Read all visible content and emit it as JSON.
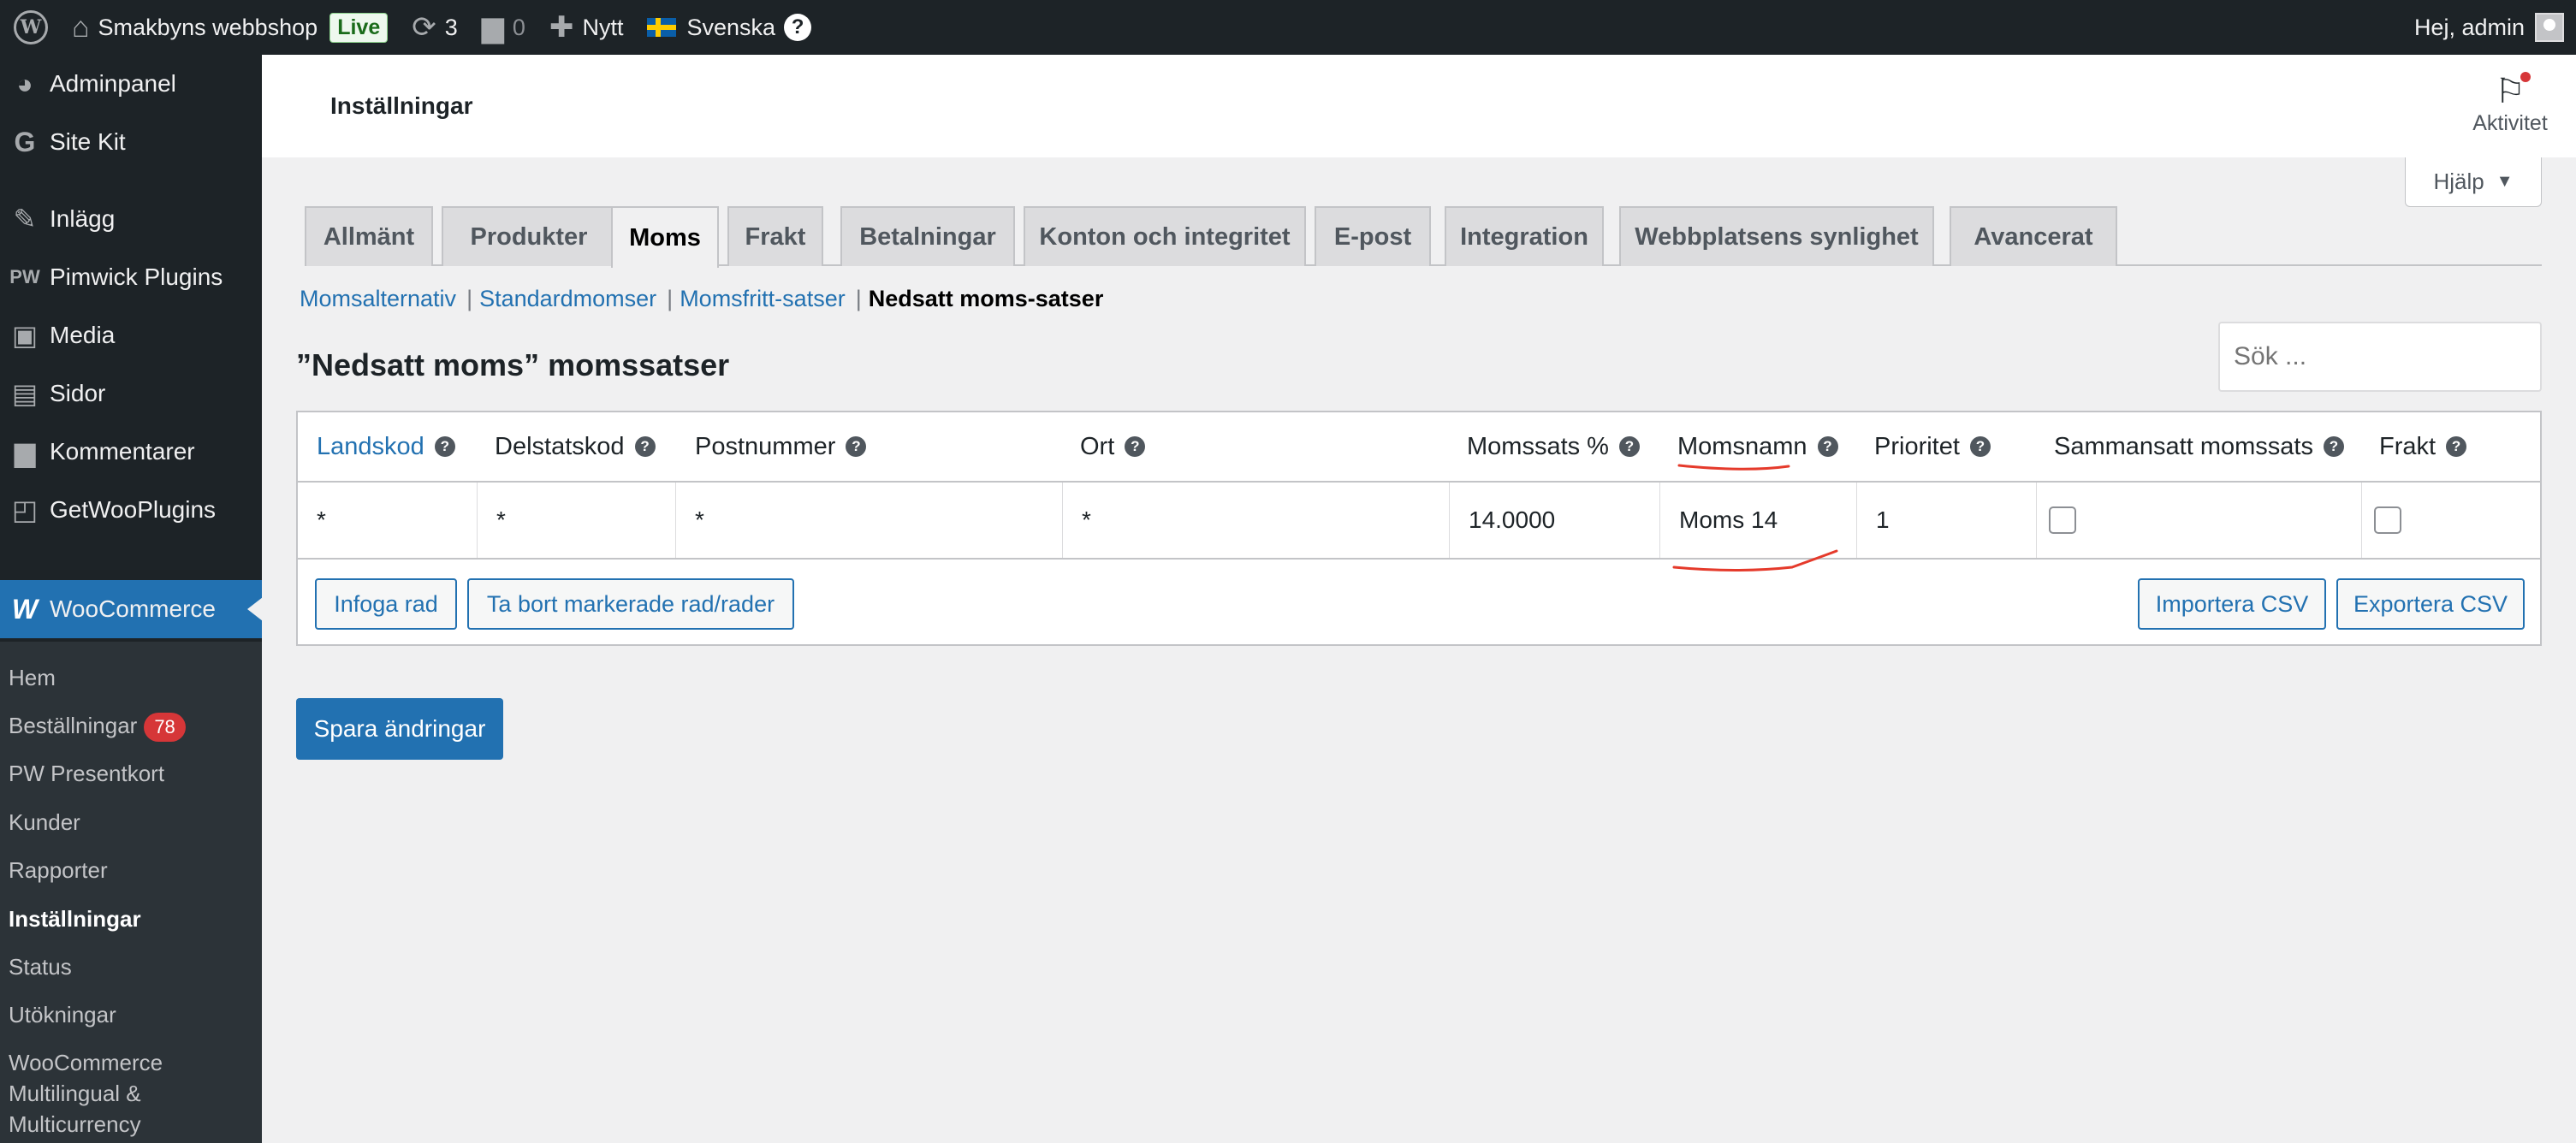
{
  "adminbar": {
    "site_name": "Smakbyns webbshop",
    "live_badge": "Live",
    "updates_count": "3",
    "comments_count": "0",
    "new_label": "Nytt",
    "language": "Svenska",
    "greeting": "Hej, admin"
  },
  "sidebar": {
    "items": [
      {
        "label": "Adminpanel",
        "icon": "dashboard-icon"
      },
      {
        "label": "Site Kit",
        "icon": "site-kit-icon"
      },
      {
        "label": "Inlägg",
        "icon": "pin-icon"
      },
      {
        "label": "Pimwick Plugins",
        "icon": "pw-icon"
      },
      {
        "label": "Media",
        "icon": "media-icon"
      },
      {
        "label": "Sidor",
        "icon": "pages-icon"
      },
      {
        "label": "Kommentarer",
        "icon": "comments-icon"
      },
      {
        "label": "GetWooPlugins",
        "icon": "plugins-icon"
      },
      {
        "label": "WooCommerce",
        "icon": "woo-icon"
      }
    ],
    "submenu": [
      {
        "label": "Hem"
      },
      {
        "label": "Beställningar",
        "badge": "78"
      },
      {
        "label": "PW Presentkort"
      },
      {
        "label": "Kunder"
      },
      {
        "label": "Rapporter"
      },
      {
        "label": "Inställningar"
      },
      {
        "label": "Status"
      },
      {
        "label": "Utökningar"
      },
      {
        "label": "WooCommerce",
        "label2": "Multilingual &",
        "label3": "Multicurrency"
      }
    ]
  },
  "header": {
    "title": "Inställningar",
    "activity_label": "Aktivitet",
    "help_label": "Hjälp"
  },
  "tabs": [
    "Allmänt",
    "Produkter",
    "Moms",
    "Frakt",
    "Betalningar",
    "Konton och integritet",
    "E-post",
    "Integration",
    "Webbplatsens synlighet",
    "Avancerat"
  ],
  "active_tab": "Moms",
  "sublinks": {
    "links": [
      "Momsalternativ",
      "Standardmomser",
      "Momsfritt-satser"
    ],
    "separator": "|",
    "current": "Nedsatt moms-satser"
  },
  "page_heading": "”Nedsatt moms” momssatser",
  "search": {
    "placeholder": "Sök ..."
  },
  "table": {
    "headers": [
      "Landskod",
      "Delstatskod",
      "Postnummer",
      "Ort",
      "Momssats %",
      "Momsnamn",
      "Prioritet",
      "Sammansatt momssats",
      "Frakt"
    ],
    "help_glyph": "?",
    "row": {
      "country": "*",
      "state": "*",
      "postcode": "*",
      "city": "*",
      "rate": "14.0000",
      "name": "Moms 14",
      "priority": "1",
      "compound": false,
      "shipping": false
    },
    "buttons": {
      "insert": "Infoga rad",
      "remove": "Ta bort markerade rad/rader",
      "import": "Importera CSV",
      "export": "Exportera CSV"
    }
  },
  "save_button": "Spara ändringar",
  "colors": {
    "accent": "#2271b1",
    "adminbar": "#1d2327",
    "badge": "#d63638",
    "annotation": "#e53a2b"
  }
}
